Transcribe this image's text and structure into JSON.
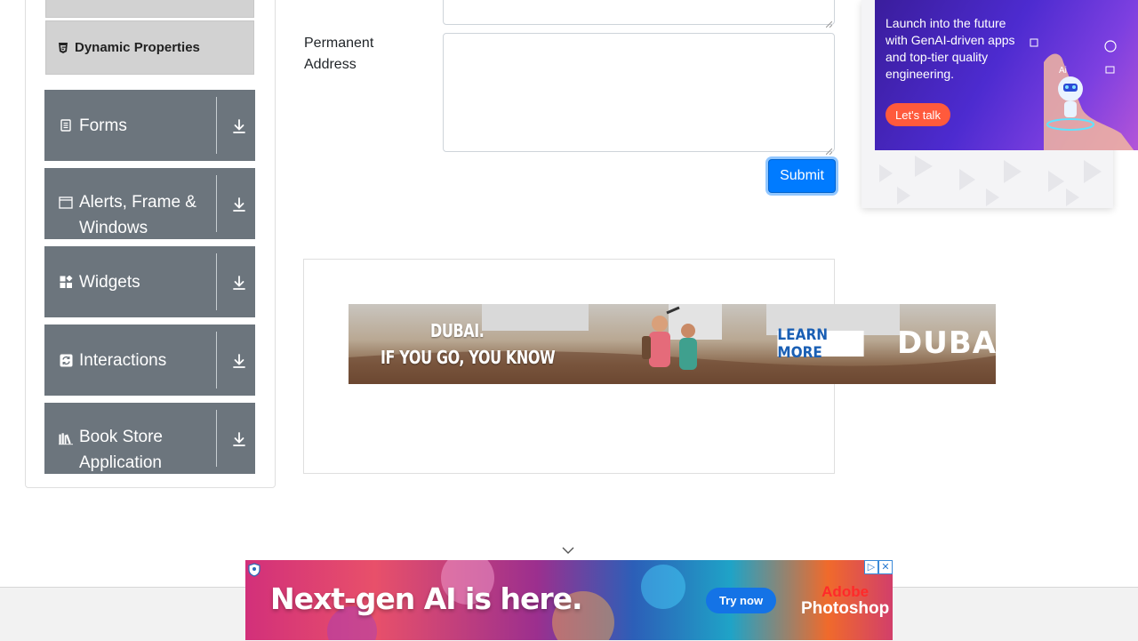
{
  "sidebar": {
    "submenu_item": {
      "label": "Dynamic Properties",
      "icon": "html5-icon"
    },
    "groups": [
      {
        "label": "Forms",
        "icon": "document-icon"
      },
      {
        "label": "Alerts, Frame &",
        "label2": "Windows",
        "icon": "window-icon"
      },
      {
        "label": "Widgets",
        "icon": "widgets-icon"
      },
      {
        "label": "Interactions",
        "icon": "interaction-icon"
      },
      {
        "label": "Book Store",
        "label2": "Application",
        "icon": "books-icon"
      }
    ]
  },
  "form": {
    "permanent_address_label_line1": "Permanent",
    "permanent_address_label_line2": "Address",
    "permanent_address_value": "",
    "submit_label": "Submit"
  },
  "ads": {
    "side": {
      "text": "Launch into the future with GenAI-driven apps and top-tier quality engineering.",
      "cta": "Let's talk"
    },
    "banner": {
      "headline_line1": "DUBAI.",
      "headline_line2": "IF YOU GO, YOU KNOW",
      "cta": "LEARN MORE",
      "brand": "DUBAI"
    },
    "bottom": {
      "headline": "Next-gen AI is here.",
      "cta": "Try now",
      "brand_line1": "Adobe",
      "brand_line2": "Photoshop"
    }
  },
  "colors": {
    "sidebar_group_bg": "#6c757d",
    "submenu_bg": "#d2d2d2",
    "submit_bg": "#007bff"
  }
}
